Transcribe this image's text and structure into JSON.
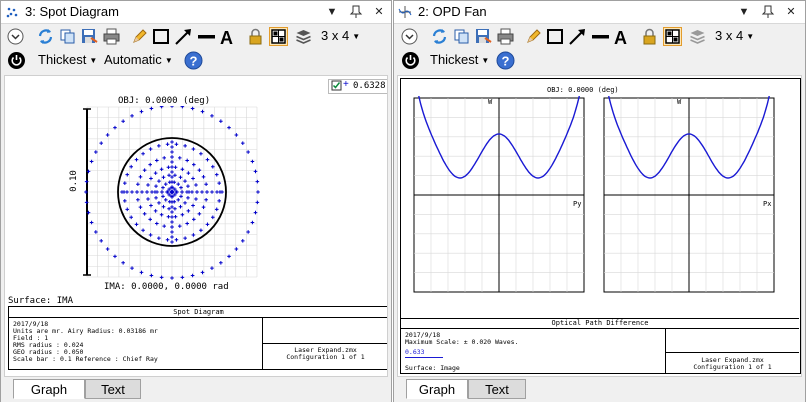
{
  "left_window": {
    "title": "3: Spot Diagram",
    "toolbar": {
      "thickness": "Thickest",
      "scaling": "Automatic",
      "layout": "3 x 4"
    },
    "plot": {
      "checkbox_value": "0.6328",
      "obj_label": "OBJ: 0.0000 (deg)",
      "scale_label": "0.10",
      "ima_label": "IMA: 0.0000, 0.0000 rad",
      "surface": "Surface: IMA"
    },
    "info": {
      "heading": "Spot Diagram",
      "date": "2017/9/18",
      "units_line": "Units are mr.      Airy Radius: 0.03186 mr",
      "field_line": "Field     :      1",
      "rms_line": "RMS radius :     0.024",
      "geo_line": "GEO radius :     0.050",
      "scale_line": "Scale bar  : 0.1      Reference   : Chief Ray",
      "file": "Laser Expand.zmx",
      "config": "Configuration 1 of 1"
    },
    "tabs": [
      "Graph",
      "Text"
    ]
  },
  "right_window": {
    "title": "2: OPD Fan",
    "toolbar": {
      "thickness": "Thickest",
      "layout": "3 x 4"
    },
    "plot": {
      "obj_label": "OBJ: 0.0000 (deg)",
      "w1": "W",
      "w2": "W",
      "py": "Py",
      "px": "Px"
    },
    "info": {
      "heading": "Optical Path Difference",
      "date": "2017/9/18",
      "max_scale": "Maximum Scale: ± 0.020 Waves.",
      "wavelength": "0.633",
      "surface": "Surface: Image",
      "file": "Laser Expand.zmx",
      "config": "Configuration 1 of 1"
    },
    "tabs": [
      "Graph",
      "Text"
    ]
  },
  "colors": {
    "accent_orange": "#e39c2c",
    "spot_blue": "#0000cc",
    "fan_blue": "#1a1ad4"
  },
  "icons": [
    "dropdown-circle-icon",
    "refresh-icon",
    "copy-icon",
    "save-icon",
    "print-icon",
    "pencil-icon",
    "rectangle-icon",
    "arrow-icon",
    "line-icon",
    "text-a-icon",
    "lock-icon",
    "crosshair-grid-icon",
    "layers-icon",
    "power-icon",
    "help-icon"
  ]
}
